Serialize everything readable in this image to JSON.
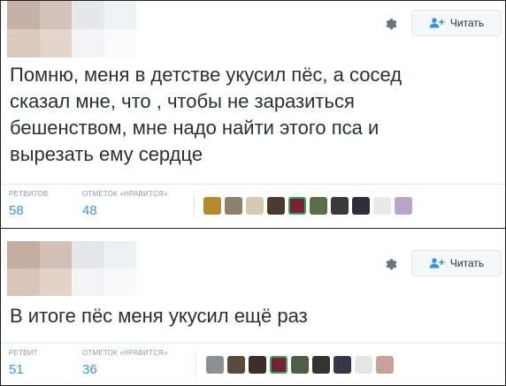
{
  "tweets": [
    {
      "text": "Помню, меня в детстве укусил пёс, а сосед\nсказал мне, что , чтобы не заразиться\nбешенством, мне надо найти этого пса и\nвырезать ему сердце",
      "follow_label": "Читать",
      "retweets_label": "РЕТВИТОВ",
      "retweets_value": "58",
      "likes_label": "ОТМЕТОК «НРАВИТСЯ»",
      "likes_value": "48"
    },
    {
      "text": "В итоге пёс меня укусил ещё раз",
      "follow_label": "Читать",
      "retweets_label": "РЕТВИТ",
      "retweets_value": "51",
      "likes_label": "ОТМЕТОК «НРАВИТСЯ»",
      "likes_value": "36"
    }
  ],
  "icons": {
    "settings": "gear-icon",
    "follow": "add-user-icon"
  },
  "colors": {
    "accent": "#3b94d9",
    "follow_icon": "#3b94d9",
    "muted": "#8899a6"
  }
}
